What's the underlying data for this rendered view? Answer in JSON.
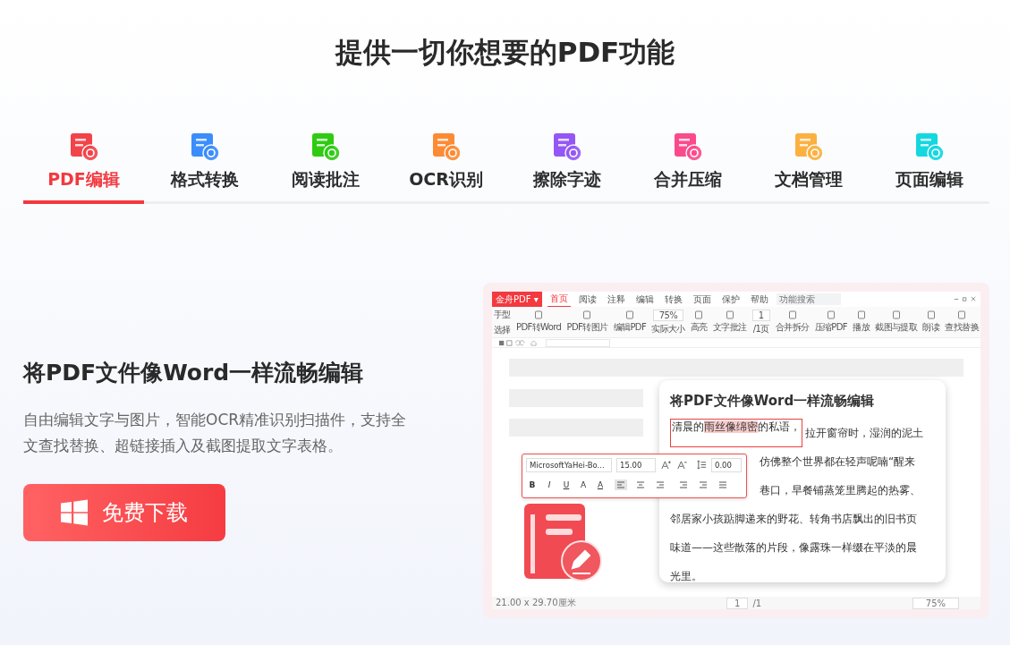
{
  "title": "提供一切你想要的PDF功能",
  "tabs": [
    {
      "label": "PDF编辑",
      "selected": true,
      "color": "#f2434a"
    },
    {
      "label": "格式转换",
      "selected": false,
      "color": "#3a8dfb"
    },
    {
      "label": "阅读批注",
      "selected": false,
      "color": "#2ecb12"
    },
    {
      "label": "OCR识别",
      "selected": false,
      "color": "#fd8a34"
    },
    {
      "label": "擦除字迹",
      "selected": false,
      "color": "#9457f5"
    },
    {
      "label": "合并压缩",
      "selected": false,
      "color": "#fb4a8c"
    },
    {
      "label": "文档管理",
      "selected": false,
      "color": "#fbb140"
    },
    {
      "label": "页面编辑",
      "selected": false,
      "color": "#14d7e0"
    }
  ],
  "feature": {
    "heading": "将PDF文件像Word一样流畅编辑",
    "description": "自由编辑文字与图片，智能OCR精准识别扫描件，支持全文查找替换、超链接插入及截图提取文字表格。",
    "button": "免费下载"
  },
  "app": {
    "logo_menu": "金舟PDF ▾",
    "menu": [
      {
        "label": "首页",
        "selected": true
      },
      {
        "label": "阅读",
        "selected": false
      },
      {
        "label": "注释",
        "selected": false
      },
      {
        "label": "编辑",
        "selected": false
      },
      {
        "label": "转换",
        "selected": false
      },
      {
        "label": "页面",
        "selected": false
      },
      {
        "label": "保护",
        "selected": false
      },
      {
        "label": "帮助",
        "selected": false
      }
    ],
    "search": {
      "placeholder": "功能搜索"
    },
    "tools_left": [
      "手型",
      "选择"
    ],
    "tools": [
      {
        "kind": "big",
        "label": "PDF转Word"
      },
      {
        "kind": "big",
        "label": "PDF转图片"
      },
      {
        "kind": "big",
        "label": "编辑PDF"
      },
      {
        "kind": "zoom",
        "value": "75%",
        "label": "实际大小"
      },
      {
        "kind": "big",
        "label": "高亮"
      },
      {
        "kind": "big",
        "label": "文字批注"
      },
      {
        "kind": "page",
        "value": "1",
        "label": "/1页"
      },
      {
        "kind": "big",
        "label": "合并拆分"
      },
      {
        "kind": "big",
        "label": "压缩PDF"
      },
      {
        "kind": "big",
        "label": "播放"
      },
      {
        "kind": "big",
        "label": "截图与提取"
      },
      {
        "kind": "big",
        "label": "朗读"
      },
      {
        "kind": "big",
        "label": "查找替换"
      }
    ],
    "doc_title": "将PDF文件像Word一样流畅编辑",
    "selection": {
      "before": "清晨的",
      "highlight": "雨丝像绵密",
      "after": "的私语，"
    },
    "lines": [
      "拉开窗帘时，湿润的泥土",
      "仿佛整个世界都在轻声呢喃“醒来",
      "巷口，早餐铺蒸笼里腾起的热雾、",
      "邻居家小孩踮脚递来的野花、转角书店飘出的旧书页",
      "味道——这些散落的片段，像露珠一样缀在平淡的晨",
      "光里。"
    ],
    "format_bar": {
      "font": "MicrosoftYaHei-Bo...",
      "size": "15.00",
      "spacing": "0.00",
      "styles": [
        "B",
        "I",
        "U",
        "A",
        "A"
      ]
    },
    "status": {
      "size": "21.00 x 29.70厘米",
      "page": "1",
      "pages": "/1",
      "zoom": "75%"
    }
  }
}
